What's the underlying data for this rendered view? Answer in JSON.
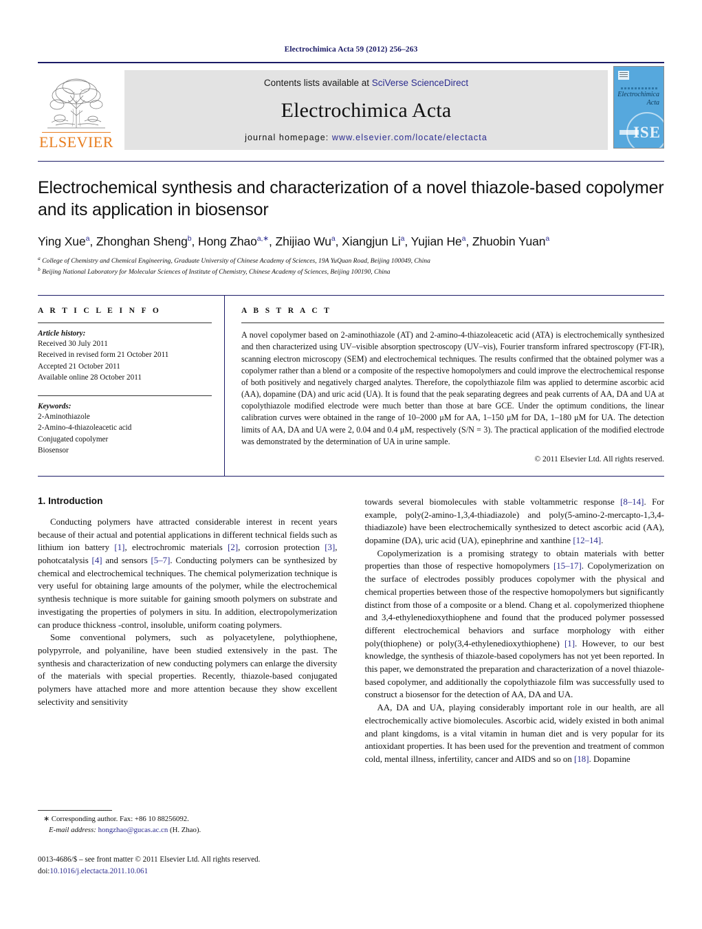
{
  "running_head": "Electrochimica Acta 59 (2012) 256–263",
  "masthead": {
    "publisher_name": "ELSEVIER",
    "contents_prefix": "Contents lists available at ",
    "contents_link": "SciVerse ScienceDirect",
    "journal_title": "Electrochimica Acta",
    "homepage_prefix": "journal homepage: ",
    "homepage_url": "www.elsevier.com/locate/electacta",
    "cover": {
      "title_line1": "Electrochimica",
      "title_line2": "Acta",
      "society_mark": "ISE"
    }
  },
  "article": {
    "title": "Electrochemical synthesis and characterization of a novel thiazole-based copolymer and its application in biosensor",
    "authors": [
      {
        "name": "Ying Xue",
        "sup": "a"
      },
      {
        "name": "Zhonghan Sheng",
        "sup": "b"
      },
      {
        "name": "Hong Zhao",
        "sup": "a,∗"
      },
      {
        "name": "Zhijiao Wu",
        "sup": "a"
      },
      {
        "name": "Xiangjun Li",
        "sup": "a"
      },
      {
        "name": "Yujian He",
        "sup": "a"
      },
      {
        "name": "Zhuobin Yuan",
        "sup": "a"
      }
    ],
    "affiliations": [
      {
        "sup": "a",
        "text": "College of Chemistry and Chemical Engineering, Graduate University of Chinese Academy of Sciences, 19A YuQuan Road, Beijing 100049, China"
      },
      {
        "sup": "b",
        "text": "Beijing National Laboratory for Molecular Sciences of Institute of Chemistry, Chinese Academy of Sciences, Beijing 100190, China"
      }
    ]
  },
  "article_info": {
    "heading": "A R T I C L E   I N F O",
    "history_label": "Article history:",
    "history": [
      "Received 30 July 2011",
      "Received in revised form 21 October 2011",
      "Accepted 21 October 2011",
      "Available online 28 October 2011"
    ],
    "keywords_label": "Keywords:",
    "keywords": [
      "2-Aminothiazole",
      "2-Amino-4-thiazoleacetic acid",
      "Conjugated copolymer",
      "Biosensor"
    ]
  },
  "abstract": {
    "heading": "A B S T R A C T",
    "text": "A novel copolymer based on 2-aminothiazole (AT) and 2-amino-4-thiazoleacetic acid (ATA) is electrochemically synthesized and then characterized using UV–visible absorption spectroscopy (UV–vis), Fourier transform infrared spectroscopy (FT-IR), scanning electron microscopy (SEM) and electrochemical techniques. The results confirmed that the obtained polymer was a copolymer rather than a blend or a composite of the respective homopolymers and could improve the electrochemical response of both positively and negatively charged analytes. Therefore, the copolythiazole film was applied to determine ascorbic acid (AA), dopamine (DA) and uric acid (UA). It is found that the peak separating degrees and peak currents of AA, DA and UA at copolythiazole modified electrode were much better than those at bare GCE. Under the optimum conditions, the linear calibration curves were obtained in the range of 10–2000 μM for AA, 1–150 μM for DA, 1–180 μM for UA. The detection limits of AA, DA and UA were 2, 0.04 and 0.4 μM, respectively (S/N = 3). The practical application of the modified electrode was demonstrated by the determination of UA in urine sample.",
    "copyright": "© 2011 Elsevier Ltd. All rights reserved."
  },
  "introduction": {
    "heading": "1.  Introduction",
    "left_paragraphs": [
      "Conducting polymers have attracted considerable interest in recent years because of their actual and potential applications in different technical fields such as lithium ion battery [1], electrochromic materials [2], corrosion protection [3], pohotcatalysis [4] and sensors [5–7]. Conducting polymers can be synthesized by chemical and electrochemical techniques. The chemical polymerization technique is very useful for obtaining large amounts of the polymer, while the electrochemical synthesis technique is more suitable for gaining smooth polymers on substrate and investigating the properties of polymers in situ. In addition, electropolymerization can produce thickness -control, insoluble, uniform coating polymers.",
      "Some conventional polymers, such as polyacetylene, polythiophene, polypyrrole, and polyaniline, have been studied extensively in the past. The synthesis and characterization of new conducting polymers can enlarge the diversity of the materials with special properties. Recently, thiazole-based conjugated polymers have attached more and more attention because they show excellent selectivity and sensitivity"
    ],
    "right_paragraphs": [
      "towards several biomolecules with stable voltammetric response [8–14]. For example, poly(2-amino-1,3,4-thiadiazole) and poly(5-amino-2-mercapto-1,3,4-thiadiazole) have been electrochemically synthesized to detect ascorbic acid (AA), dopamine (DA), uric acid (UA), epinephrine and xanthine [12–14].",
      "Copolymerization is a promising strategy to obtain materials with better properties than those of respective homopolymers [15–17]. Copolymerization on the surface of electrodes possibly produces copolymer with the physical and chemical properties between those of the respective homopolymers but significantly distinct from those of a composite or a blend. Chang et al. copolymerized thiophene and 3,4-ethylenedioxythiophene and found that the produced polymer possessed different electrochemical behaviors and surface morphology with either poly(thiophene) or poly(3,4-ethylenedioxythiophene) [1]. However, to our best knowledge, the synthesis of thiazole-based copolymers has not yet been reported. In this paper, we demonstrated the preparation and characterization of a novel thiazole-based copolymer, and additionally the copolythiazole film was successfully used to construct a biosensor for the detection of AA, DA and UA.",
      "AA, DA and UA, playing considerably important role in our health, are all electrochemically active biomolecules. Ascorbic acid, widely existed in both animal and plant kingdoms, is a vital vitamin in human diet and is very popular for its antioxidant properties. It has been used for the prevention and treatment of common cold, mental illness, infertility, cancer and AIDS and so on [18]. Dopamine"
    ]
  },
  "footnote": {
    "corresponding_marker": "∗",
    "corresponding_text": "Corresponding author. Fax: +86 10 88256092.",
    "email_label": "E-mail address:",
    "email": "hongzhao@gucas.ac.cn",
    "email_owner": "(H. Zhao)."
  },
  "imprint": {
    "issn_line": "0013-4686/$ – see front matter © 2011 Elsevier Ltd. All rights reserved.",
    "doi_label": "doi:",
    "doi_value": "10.1016/j.electacta.2011.10.061"
  },
  "colors": {
    "link_blue": "#2b2b8f",
    "elsevier_orange": "#E87D1E",
    "cover_blue": "#56a8dd",
    "rule_navy": "#1a1a66"
  }
}
